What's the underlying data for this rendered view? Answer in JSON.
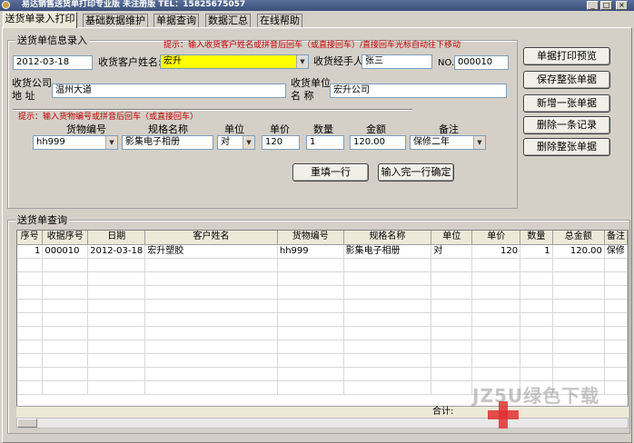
{
  "window": {
    "title": "易达销售送货单打印专业版  未注册版   TEL：15825675057"
  },
  "tabs": [
    {
      "label": "送货单录入打印"
    },
    {
      "label": "基础数据维护"
    },
    {
      "label": "单据查询"
    },
    {
      "label": "数据汇总"
    },
    {
      "label": "在线帮助"
    }
  ],
  "entry": {
    "group_title": "送货单信息录入",
    "hint_top": "提示：输入收货客户姓名或拼音后回车（或直接回车）/直接回车光标自动往下移动",
    "date_value": "2012-03-18",
    "customer_label": "收货客户姓名:",
    "customer_value": "宏升",
    "handler_label": "收货经手人",
    "handler_value": "张三",
    "no_label": "NO.",
    "no_value": "000010",
    "address_label_1": "收货公司",
    "address_label_2": "地    址",
    "address_value": "温州大道",
    "unit_label_1": "收货单位",
    "unit_label_2": "名    称",
    "unit_value": "宏升公司",
    "hint_goods": "提示：输入货物编号或拼音后回车（或直接回车）",
    "col_code": "货物编号",
    "col_spec": "规格名称",
    "col_unit": "单位",
    "col_price": "单价",
    "col_qty": "数量",
    "col_amount": "金额",
    "col_note": "备注",
    "code_value": "hh999",
    "spec_value": "影集电子相册",
    "unit_value_sel": "对",
    "price_value": "120",
    "qty_value": "1",
    "amount_value": "120.00",
    "note_value": "保修二年",
    "refill_button": "重填一行",
    "confirm_button": "输入完一行确定"
  },
  "side_buttons": [
    {
      "label": "单据打印预览"
    },
    {
      "label": "保存整张单据"
    },
    {
      "label": "新增一张单据"
    },
    {
      "label": "删除一条记录"
    },
    {
      "label": "删除整张单据"
    }
  ],
  "query": {
    "group_title": "送货单查询",
    "columns": [
      "序号",
      "收据序号",
      "日期",
      "客户姓名",
      "货物编号",
      "规格名称",
      "单位",
      "单价",
      "数量",
      "总金额",
      "备注"
    ],
    "rows": [
      [
        "1",
        "000010",
        "2012-03-18",
        "宏升塑胶",
        "hh999",
        "影集电子相册",
        "对",
        "120",
        "1",
        "120.00",
        "保修"
      ]
    ],
    "total_label": "合计:"
  },
  "watermark": "JZ5U绿色下载"
}
